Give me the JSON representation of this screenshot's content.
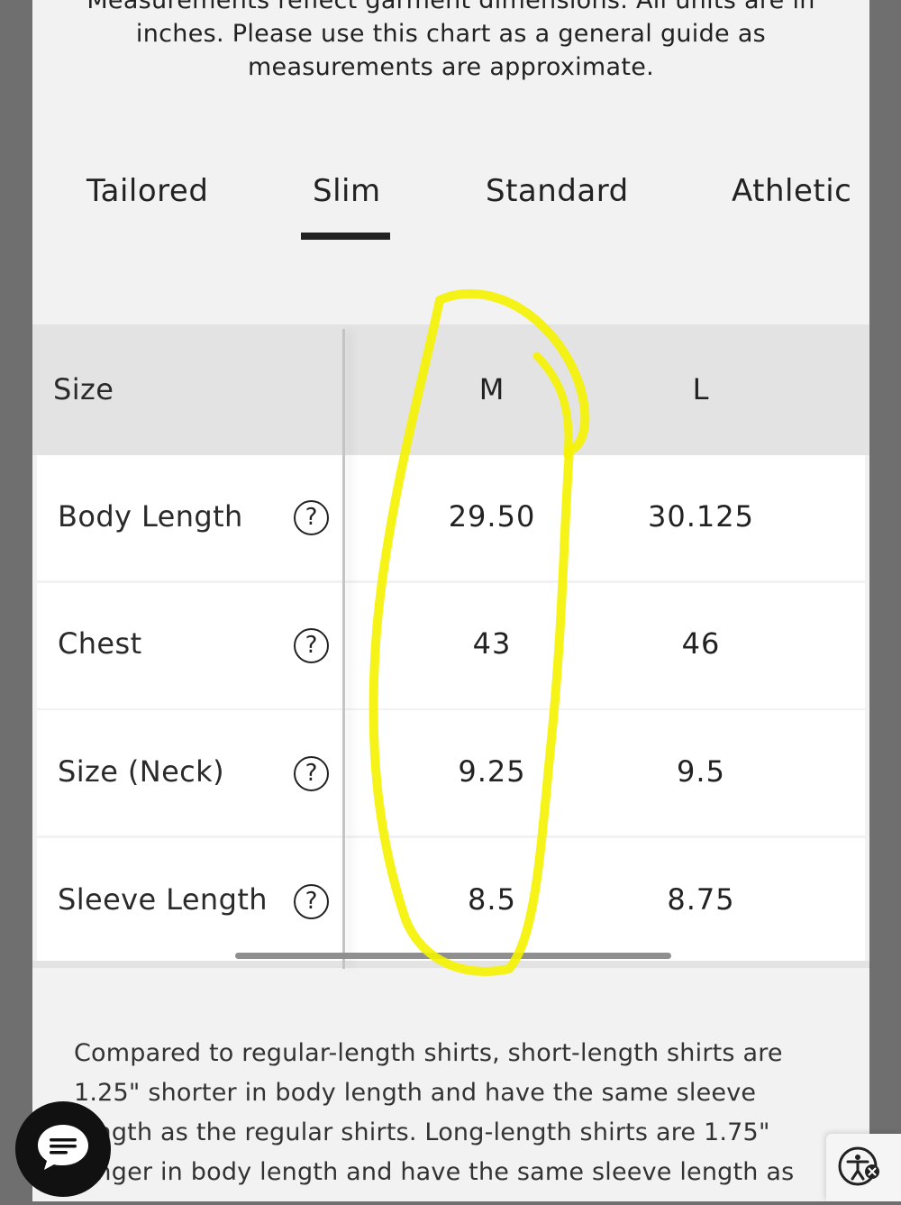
{
  "intro_lines": [
    "Measurements reflect garment dimensions. All units are in",
    "inches. Please use this chart as a general guide as",
    "measurements are approximate."
  ],
  "tabs": [
    {
      "label": "Tailored"
    },
    {
      "label": "Slim",
      "active": true
    },
    {
      "label": "Standard"
    },
    {
      "label": "Athletic"
    }
  ],
  "table": {
    "header": {
      "label": "Size",
      "sizes": [
        "M",
        "L"
      ]
    },
    "rows": [
      {
        "label": "Body Length",
        "values": [
          "29.50",
          "30.125"
        ]
      },
      {
        "label": "Chest",
        "values": [
          "43",
          "46"
        ]
      },
      {
        "label": "Size (Neck)",
        "values": [
          "9.25",
          "9.5"
        ]
      },
      {
        "label": "Sleeve Length",
        "values": [
          "8.5",
          "8.75"
        ]
      }
    ],
    "help_glyph": "?"
  },
  "note_lines": [
    "Compared to regular-length shirts, short-length shirts are",
    "1.25\" shorter in body length and have the same sleeve",
    "length as the regular shirts. Long-length shirts are 1.75\"",
    "longer in body length and have the same sleeve length as"
  ],
  "icons": {
    "chat": "chat-icon",
    "accessibility": "accessibility-icon"
  },
  "colors": {
    "highlight": "#f5f200",
    "active_underline": "#222222"
  }
}
